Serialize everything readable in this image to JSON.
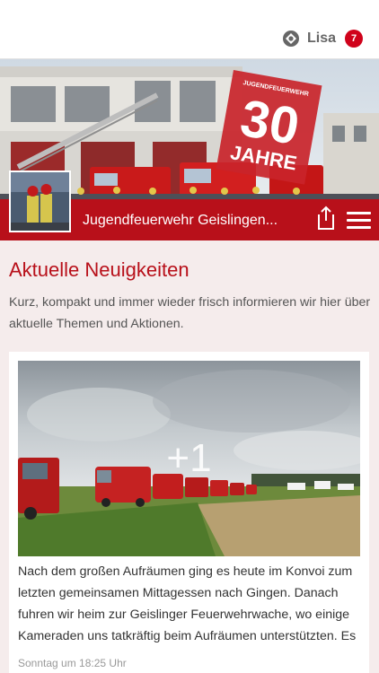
{
  "header": {
    "user_name": "Lisa",
    "notification_count": "7",
    "user_icon": "network-icon"
  },
  "group": {
    "title": "Jugendfeuerwehr Geislingen...",
    "banner_text": "30",
    "banner_sub": "JAHRE",
    "banner_top": "JUGENDFEUERWEHR",
    "share_icon": "share-icon",
    "menu_icon": "hamburger-menu-icon"
  },
  "news": {
    "title": "Aktuelle Neuigkeiten",
    "description": "Kurz, kompakt und immer wieder frisch informieren wir hier über aktuelle Themen und Aktionen."
  },
  "post": {
    "photo_more": "+1",
    "text": "Nach dem großen Aufräumen ging es heute im Konvoi zum letzten gemeinsamen Mittagessen nach Gingen. Danach fuhren wir heim zur Geislinger Feuerwehrwache, wo einige Kameraden uns tatkräftig beim Aufräumen unterstützten. Es",
    "timestamp": "Sonntag um 18:25 Uhr"
  },
  "colors": {
    "accent": "#b8101a",
    "badge": "#d0021b",
    "background": "#f5ecec"
  }
}
